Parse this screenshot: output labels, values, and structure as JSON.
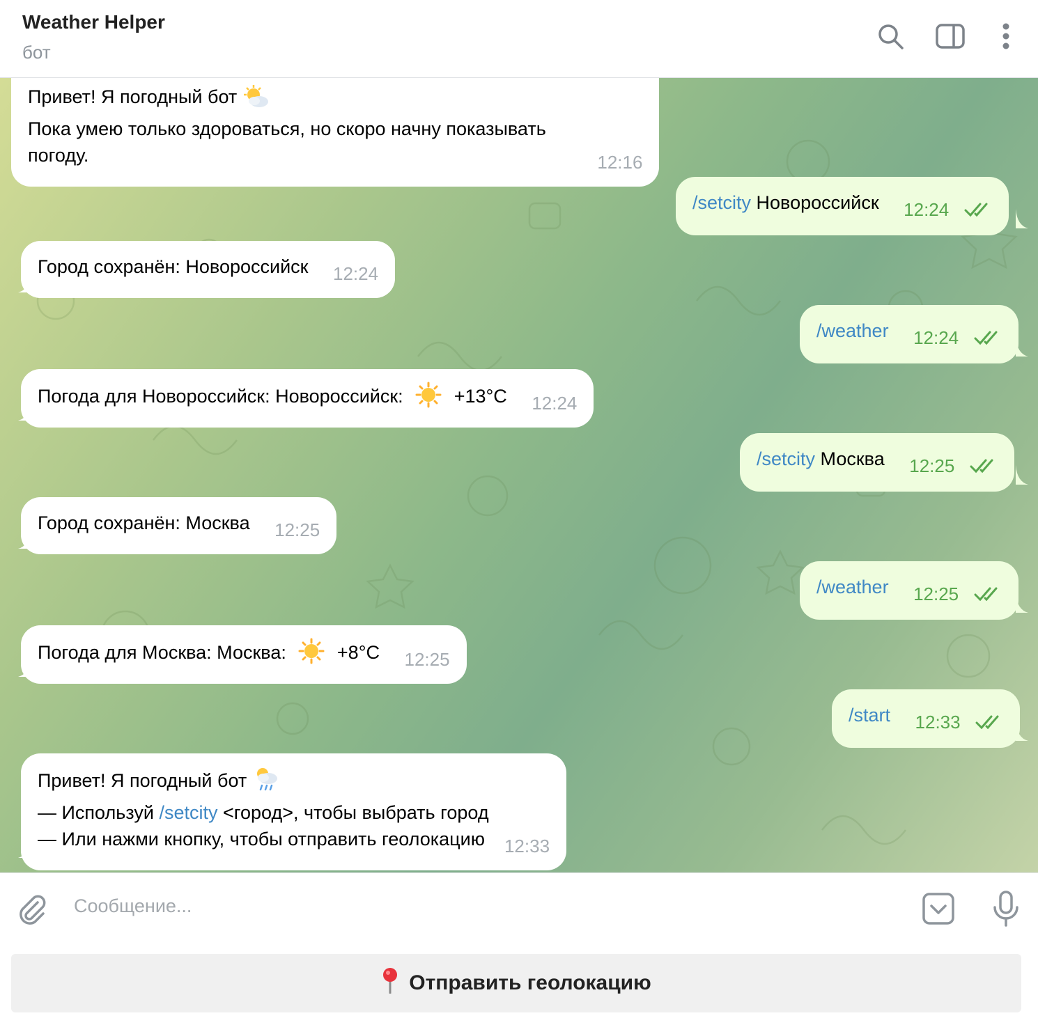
{
  "header": {
    "title": "Weather Helper",
    "subtitle": "бот",
    "icons": [
      "search-icon",
      "sidebar-toggle-icon",
      "more-vertical-icon"
    ]
  },
  "messages": [
    {
      "dir": "in",
      "lines": [
        "Привет! Я погодный бот",
        "Пока умею только здороваться, но скоро начну показывать",
        "погоду."
      ],
      "emoji": "sun-behind-cloud",
      "time": "12:16"
    },
    {
      "dir": "out",
      "command": "/setcity",
      "text": "Новороссийск",
      "time": "12:24"
    },
    {
      "dir": "in",
      "text": "Город сохранён: Новороссийск",
      "time": "12:24"
    },
    {
      "dir": "out",
      "command": "/weather",
      "text": "",
      "time": "12:24"
    },
    {
      "dir": "in",
      "text": "Погода для Новороссийск: Новороссийск:",
      "emoji": "sun",
      "temp": "+13°C",
      "time": "12:24"
    },
    {
      "dir": "out",
      "command": "/setcity",
      "text": "Москва",
      "time": "12:25"
    },
    {
      "dir": "in",
      "text": "Город сохранён: Москва",
      "time": "12:25"
    },
    {
      "dir": "out",
      "command": "/weather",
      "text": "",
      "time": "12:25"
    },
    {
      "dir": "in",
      "text": "Погода для Москва: Москва:",
      "emoji": "sun",
      "temp": "+8°C",
      "time": "12:25"
    },
    {
      "dir": "out",
      "command": "/start",
      "text": "",
      "time": "12:33"
    },
    {
      "dir": "in",
      "line1": "Привет! Я погодный бот",
      "line2_prefix": "— Используй",
      "line2_cmd": "/setcity",
      "line2_suffix": "<город>, чтобы выбрать город",
      "line3": "— Или нажми кнопку, чтобы отправить геолокацию",
      "emoji": "cloud-with-rain",
      "time": "12:33"
    }
  ],
  "composer": {
    "placeholder": "Сообщение...",
    "icons": [
      "attach-icon",
      "keyboard-toggle-icon",
      "microphone-icon"
    ]
  },
  "keyboard": {
    "button_label": "Отправить геолокацию",
    "button_icon": "round-pushpin-icon"
  },
  "colors": {
    "incoming_bubble": "#ffffff",
    "outgoing_bubble": "#effdde",
    "command_link": "#3f88c5",
    "outgoing_time": "#58a74e",
    "incoming_time": "#a6acb2"
  }
}
